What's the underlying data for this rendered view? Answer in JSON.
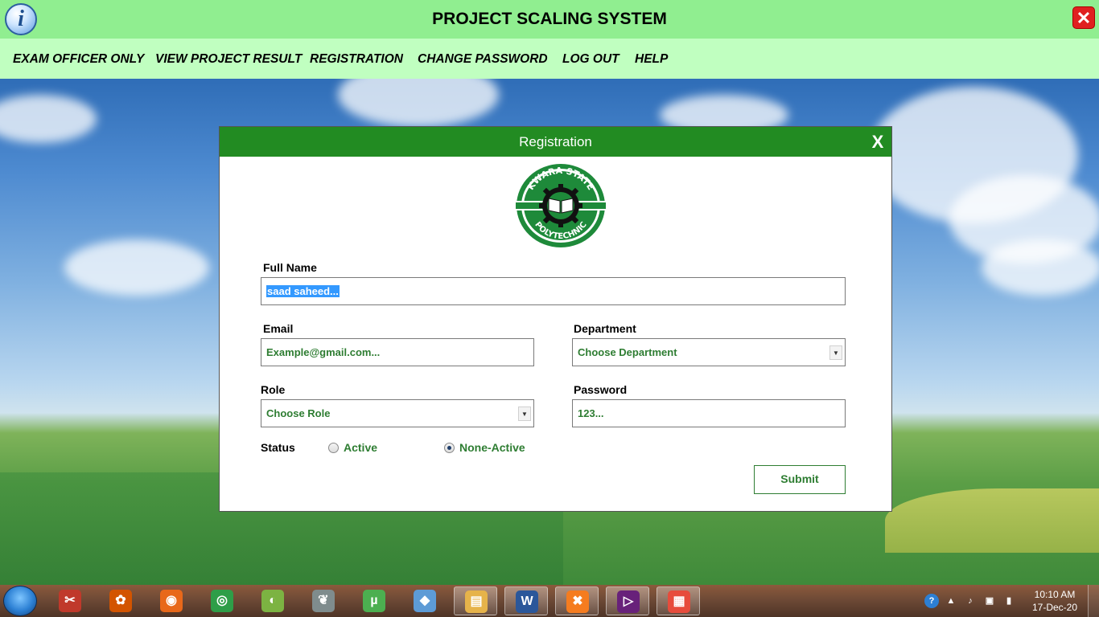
{
  "app": {
    "title": "PROJECT SCALING SYSTEM",
    "info_icon_glyph": "i",
    "close_glyph": "✕"
  },
  "menu": {
    "items": [
      {
        "label": "EXAM OFFICER ONLY"
      },
      {
        "label": "VIEW PROJECT RESULT"
      },
      {
        "label": "REGISTRATION"
      },
      {
        "label": "CHANGE PASSWORD"
      },
      {
        "label": "LOG OUT"
      },
      {
        "label": "HELP"
      }
    ]
  },
  "dialog": {
    "title": "Registration",
    "close_label": "X",
    "logo": {
      "top_text": "KWARA STATE",
      "bottom_text": "POLYTECHNIC"
    },
    "full_name": {
      "label": "Full Name",
      "value": "saad saheed..."
    },
    "email": {
      "label": "Email",
      "value": "Example@gmail.com..."
    },
    "department": {
      "label": "Department",
      "value": "Choose Department"
    },
    "role": {
      "label": "Role",
      "value": "Choose Role"
    },
    "password": {
      "label": "Password",
      "value": "123..."
    },
    "status": {
      "label": "Status",
      "options": [
        {
          "label": "Active",
          "selected": false
        },
        {
          "label": "None-Active",
          "selected": true
        }
      ]
    },
    "submit_label": "Submit"
  },
  "taskbar": {
    "apps": [
      {
        "icon": "snipping-tool-icon",
        "glyph": "✂",
        "color": "#c0392b",
        "active": false
      },
      {
        "icon": "cake-app-icon",
        "glyph": "✿",
        "color": "#d35400",
        "active": false
      },
      {
        "icon": "firefox-icon",
        "glyph": "◉",
        "color": "#e8681a",
        "active": false
      },
      {
        "icon": "chrome-icon",
        "glyph": "◎",
        "color": "#2e9e48",
        "active": false
      },
      {
        "icon": "chameleon-icon",
        "glyph": "◐",
        "color": "#7cb342",
        "active": false
      },
      {
        "icon": "feather-icon",
        "glyph": "❦",
        "color": "#7f8c8d",
        "active": false
      },
      {
        "icon": "utorrent-icon",
        "glyph": "µ",
        "color": "#4caf50",
        "active": false
      },
      {
        "icon": "cube-app-icon",
        "glyph": "◆",
        "color": "#5d9bd6",
        "active": false
      },
      {
        "icon": "file-explorer-icon",
        "glyph": "▤",
        "color": "#e6b34a",
        "active": true
      },
      {
        "icon": "word-icon",
        "glyph": "W",
        "color": "#2b579a",
        "active": true
      },
      {
        "icon": "xampp-icon",
        "glyph": "✖",
        "color": "#f57c1f",
        "active": true
      },
      {
        "icon": "visual-studio-icon",
        "glyph": "▷",
        "color": "#68217a",
        "active": true
      },
      {
        "icon": "windows-forms-app-icon",
        "glyph": "▦",
        "color": "#e74c3c",
        "active": true
      }
    ],
    "tray_icons": [
      {
        "icon": "help-tray-icon",
        "glyph": "?"
      },
      {
        "icon": "show-hidden-icons-arrow",
        "glyph": "▲"
      },
      {
        "icon": "volume-icon",
        "glyph": "♪"
      },
      {
        "icon": "device-icon",
        "glyph": "▣"
      },
      {
        "icon": "network-signal-icon",
        "glyph": "▮"
      }
    ],
    "time": "10:10 AM",
    "date": "17-Dec-20"
  }
}
